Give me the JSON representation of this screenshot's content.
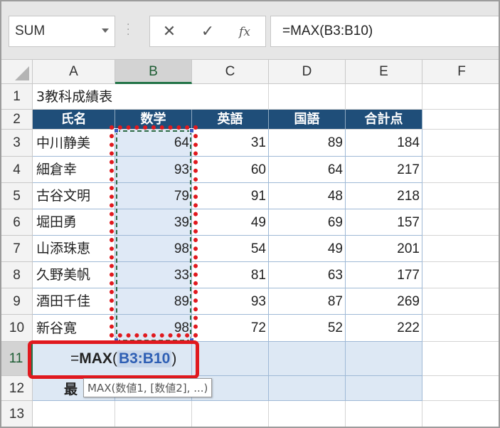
{
  "name_box": {
    "value": "SUM"
  },
  "formula_bar": {
    "cancel_glyph": "✕",
    "enter_glyph": "✓",
    "fx_label": "fx",
    "content": "=MAX(B3:B10)"
  },
  "columns": [
    "A",
    "B",
    "C",
    "D",
    "E",
    "F"
  ],
  "rows": [
    "1",
    "2",
    "3",
    "4",
    "5",
    "6",
    "7",
    "8",
    "9",
    "10",
    "11",
    "12",
    "13"
  ],
  "title": "3教科成績表",
  "table": {
    "headers": [
      "氏名",
      "数学",
      "英語",
      "国語",
      "合計点"
    ],
    "rows": [
      [
        "中川静美",
        "64",
        "31",
        "89",
        "184"
      ],
      [
        "細倉幸",
        "93",
        "60",
        "64",
        "217"
      ],
      [
        "古谷文明",
        "79",
        "91",
        "48",
        "218"
      ],
      [
        "堀田勇",
        "39",
        "49",
        "69",
        "157"
      ],
      [
        "山添珠恵",
        "98",
        "54",
        "49",
        "201"
      ],
      [
        "久野美帆",
        "33",
        "81",
        "63",
        "177"
      ],
      [
        "酒田千佳",
        "89",
        "93",
        "87",
        "269"
      ],
      [
        "新谷寛",
        "98",
        "72",
        "52",
        "222"
      ]
    ]
  },
  "editing_cell": {
    "prefix": "=",
    "func": "MAX",
    "open_paren": "(",
    "range": "B3:B10",
    "close_paren": ")"
  },
  "row12_label_partial": "最",
  "tooltip": "MAX(数値1, [数値2], ...)",
  "colors": {
    "header_fill": "#1f4e79",
    "selected_range_fill": "#dfe9f6",
    "highlight_red": "#e0191e",
    "marquee_green": "#2e6b45",
    "range_ref_blue": "#2e5fb4"
  }
}
